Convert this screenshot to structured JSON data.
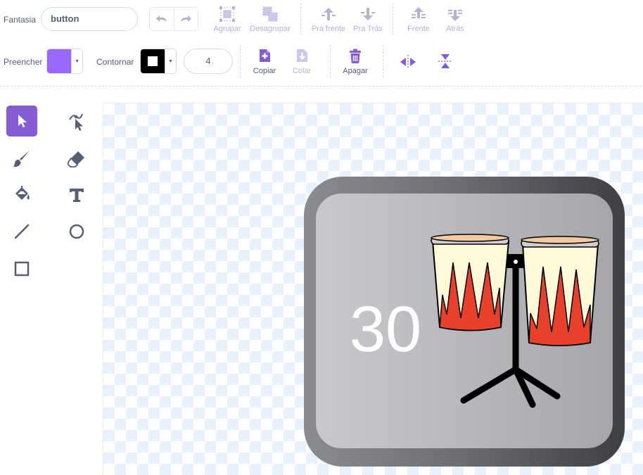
{
  "costume": {
    "label": "Fantasia",
    "name": "button"
  },
  "toolbar": {
    "group": "Agrupar",
    "ungroup": "Desagrupar",
    "forward": "Pra frente",
    "backward": "Pra Trás",
    "front": "Frente",
    "back": "Atrás",
    "copy": "Copiar",
    "paste": "Colar",
    "delete": "Apagar"
  },
  "fill": {
    "label": "Preencher",
    "color": "#9966ff"
  },
  "outline": {
    "label": "Contornar",
    "color": "#000000",
    "width": "4"
  },
  "tools": [
    "select",
    "reshape",
    "brush",
    "eraser",
    "fill",
    "text",
    "line",
    "circle",
    "rectangle"
  ],
  "canvas": {
    "button_number": "30"
  },
  "colors": {
    "accent": "#855cd6",
    "disabled": "#b6b0d4",
    "text": "#575e75"
  }
}
